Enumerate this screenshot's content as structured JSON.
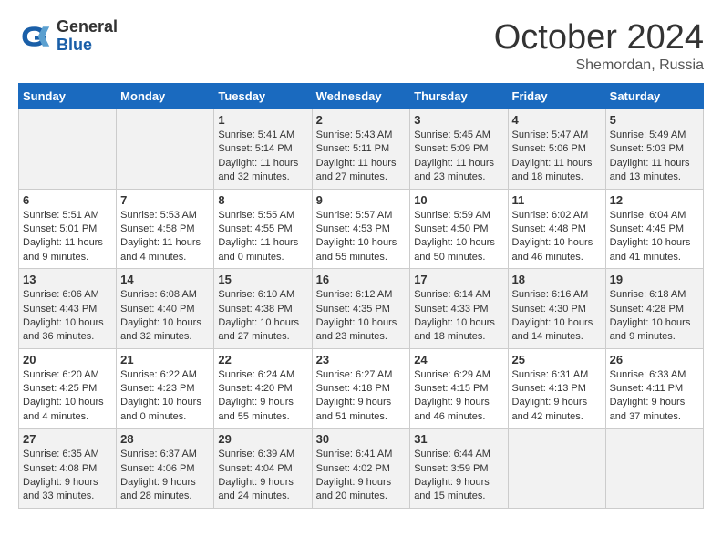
{
  "header": {
    "logo_general": "General",
    "logo_blue": "Blue",
    "title": "October 2024",
    "subtitle": "Shemordan, Russia"
  },
  "weekdays": [
    "Sunday",
    "Monday",
    "Tuesday",
    "Wednesday",
    "Thursday",
    "Friday",
    "Saturday"
  ],
  "weeks": [
    [
      {
        "day": "",
        "info": ""
      },
      {
        "day": "",
        "info": ""
      },
      {
        "day": "1",
        "info": "Sunrise: 5:41 AM\nSunset: 5:14 PM\nDaylight: 11 hours and 32 minutes."
      },
      {
        "day": "2",
        "info": "Sunrise: 5:43 AM\nSunset: 5:11 PM\nDaylight: 11 hours and 27 minutes."
      },
      {
        "day": "3",
        "info": "Sunrise: 5:45 AM\nSunset: 5:09 PM\nDaylight: 11 hours and 23 minutes."
      },
      {
        "day": "4",
        "info": "Sunrise: 5:47 AM\nSunset: 5:06 PM\nDaylight: 11 hours and 18 minutes."
      },
      {
        "day": "5",
        "info": "Sunrise: 5:49 AM\nSunset: 5:03 PM\nDaylight: 11 hours and 13 minutes."
      }
    ],
    [
      {
        "day": "6",
        "info": "Sunrise: 5:51 AM\nSunset: 5:01 PM\nDaylight: 11 hours and 9 minutes."
      },
      {
        "day": "7",
        "info": "Sunrise: 5:53 AM\nSunset: 4:58 PM\nDaylight: 11 hours and 4 minutes."
      },
      {
        "day": "8",
        "info": "Sunrise: 5:55 AM\nSunset: 4:55 PM\nDaylight: 11 hours and 0 minutes."
      },
      {
        "day": "9",
        "info": "Sunrise: 5:57 AM\nSunset: 4:53 PM\nDaylight: 10 hours and 55 minutes."
      },
      {
        "day": "10",
        "info": "Sunrise: 5:59 AM\nSunset: 4:50 PM\nDaylight: 10 hours and 50 minutes."
      },
      {
        "day": "11",
        "info": "Sunrise: 6:02 AM\nSunset: 4:48 PM\nDaylight: 10 hours and 46 minutes."
      },
      {
        "day": "12",
        "info": "Sunrise: 6:04 AM\nSunset: 4:45 PM\nDaylight: 10 hours and 41 minutes."
      }
    ],
    [
      {
        "day": "13",
        "info": "Sunrise: 6:06 AM\nSunset: 4:43 PM\nDaylight: 10 hours and 36 minutes."
      },
      {
        "day": "14",
        "info": "Sunrise: 6:08 AM\nSunset: 4:40 PM\nDaylight: 10 hours and 32 minutes."
      },
      {
        "day": "15",
        "info": "Sunrise: 6:10 AM\nSunset: 4:38 PM\nDaylight: 10 hours and 27 minutes."
      },
      {
        "day": "16",
        "info": "Sunrise: 6:12 AM\nSunset: 4:35 PM\nDaylight: 10 hours and 23 minutes."
      },
      {
        "day": "17",
        "info": "Sunrise: 6:14 AM\nSunset: 4:33 PM\nDaylight: 10 hours and 18 minutes."
      },
      {
        "day": "18",
        "info": "Sunrise: 6:16 AM\nSunset: 4:30 PM\nDaylight: 10 hours and 14 minutes."
      },
      {
        "day": "19",
        "info": "Sunrise: 6:18 AM\nSunset: 4:28 PM\nDaylight: 10 hours and 9 minutes."
      }
    ],
    [
      {
        "day": "20",
        "info": "Sunrise: 6:20 AM\nSunset: 4:25 PM\nDaylight: 10 hours and 4 minutes."
      },
      {
        "day": "21",
        "info": "Sunrise: 6:22 AM\nSunset: 4:23 PM\nDaylight: 10 hours and 0 minutes."
      },
      {
        "day": "22",
        "info": "Sunrise: 6:24 AM\nSunset: 4:20 PM\nDaylight: 9 hours and 55 minutes."
      },
      {
        "day": "23",
        "info": "Sunrise: 6:27 AM\nSunset: 4:18 PM\nDaylight: 9 hours and 51 minutes."
      },
      {
        "day": "24",
        "info": "Sunrise: 6:29 AM\nSunset: 4:15 PM\nDaylight: 9 hours and 46 minutes."
      },
      {
        "day": "25",
        "info": "Sunrise: 6:31 AM\nSunset: 4:13 PM\nDaylight: 9 hours and 42 minutes."
      },
      {
        "day": "26",
        "info": "Sunrise: 6:33 AM\nSunset: 4:11 PM\nDaylight: 9 hours and 37 minutes."
      }
    ],
    [
      {
        "day": "27",
        "info": "Sunrise: 6:35 AM\nSunset: 4:08 PM\nDaylight: 9 hours and 33 minutes."
      },
      {
        "day": "28",
        "info": "Sunrise: 6:37 AM\nSunset: 4:06 PM\nDaylight: 9 hours and 28 minutes."
      },
      {
        "day": "29",
        "info": "Sunrise: 6:39 AM\nSunset: 4:04 PM\nDaylight: 9 hours and 24 minutes."
      },
      {
        "day": "30",
        "info": "Sunrise: 6:41 AM\nSunset: 4:02 PM\nDaylight: 9 hours and 20 minutes."
      },
      {
        "day": "31",
        "info": "Sunrise: 6:44 AM\nSunset: 3:59 PM\nDaylight: 9 hours and 15 minutes."
      },
      {
        "day": "",
        "info": ""
      },
      {
        "day": "",
        "info": ""
      }
    ]
  ]
}
